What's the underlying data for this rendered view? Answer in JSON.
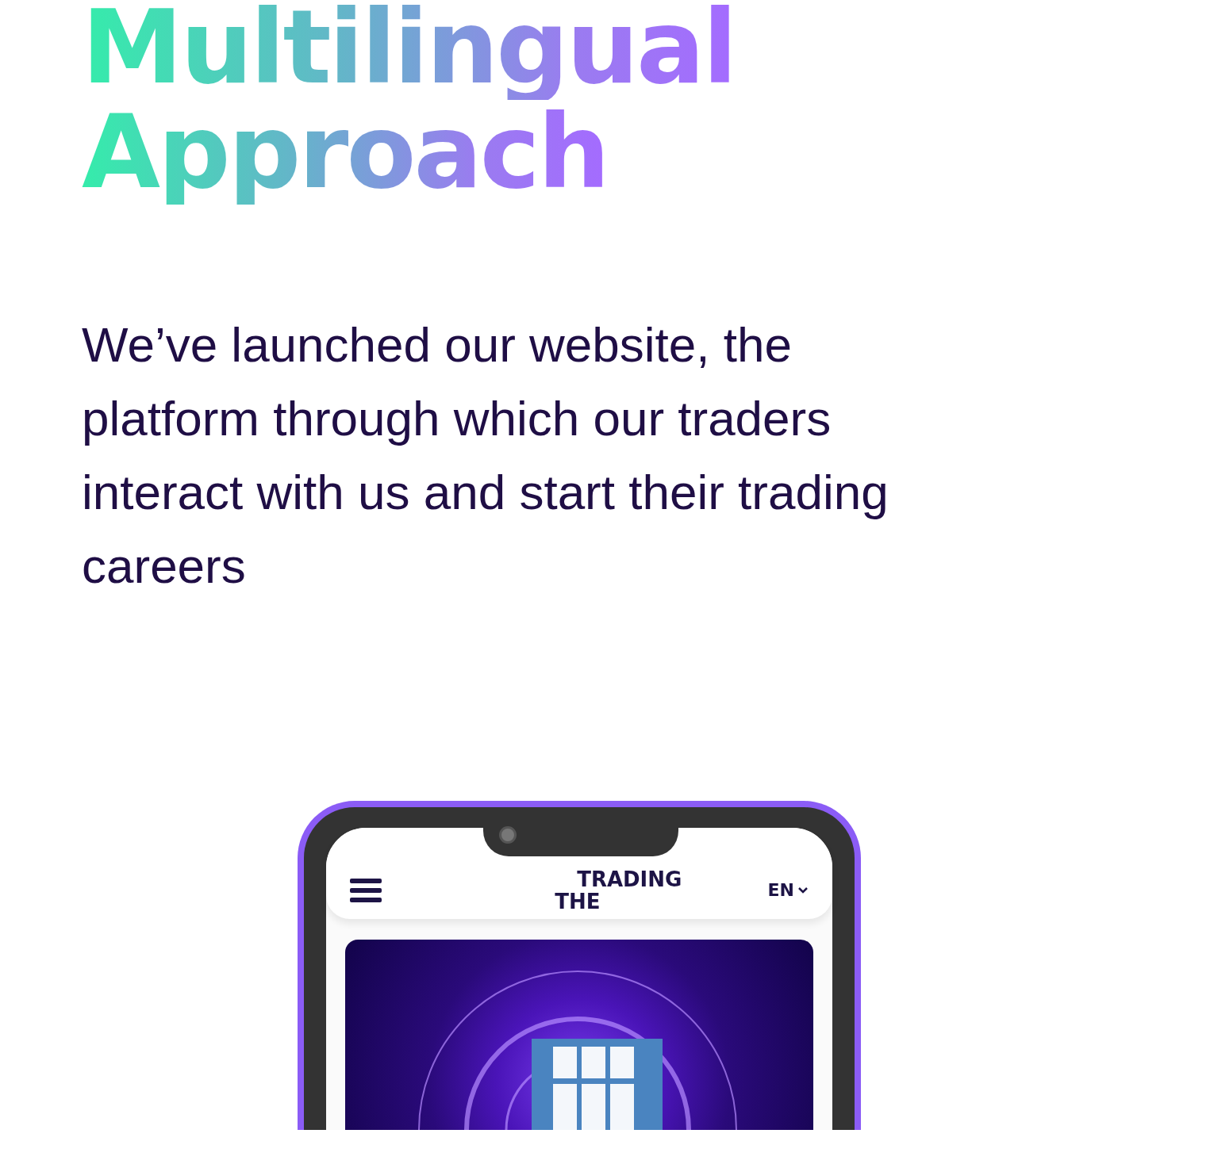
{
  "heading": {
    "lines": [
      "Multilingual",
      "Approach"
    ]
  },
  "intro": "We’ve launched our website, the platform through which our traders interact with us and start their trading careers",
  "phone": {
    "logo": {
      "top": "TRADING",
      "bottom": "THE"
    },
    "language": "EN"
  }
}
